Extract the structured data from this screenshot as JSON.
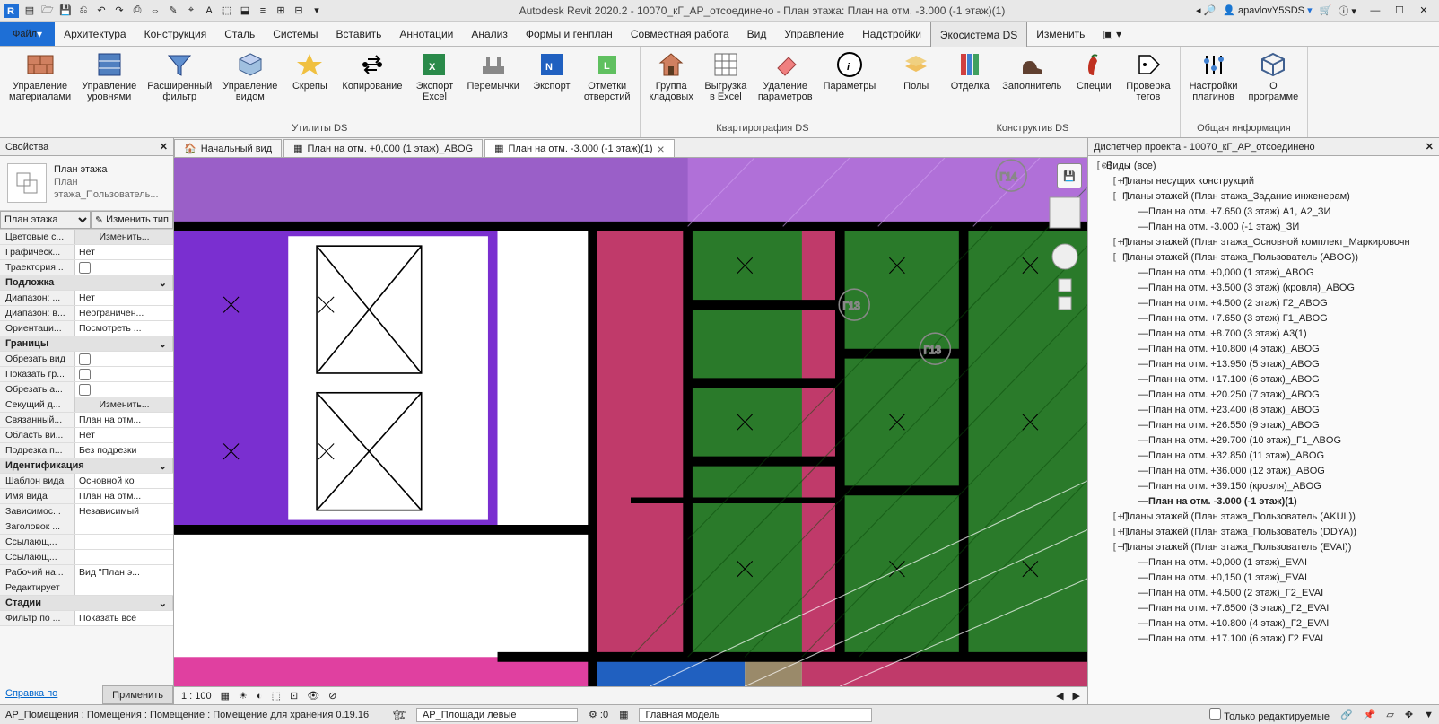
{
  "title": "Autodesk Revit 2020.2 - 10070_кГ_АР_отсоединено - План этажа: План на отм. -3.000 (-1 этаж)(1)",
  "user": "apavlovY5SDS",
  "menu": {
    "file": "Файл",
    "items": [
      "Архитектура",
      "Конструкция",
      "Сталь",
      "Системы",
      "Вставить",
      "Аннотации",
      "Анализ",
      "Формы и генплан",
      "Совместная работа",
      "Вид",
      "Управление",
      "Надстройки",
      "Экосистема DS",
      "Изменить"
    ],
    "active": 12
  },
  "ribbon": [
    {
      "label": "Утилиты DS",
      "btns": [
        {
          "t": "Управление\nматериалами",
          "icon": "bricks"
        },
        {
          "t": "Управление\nуровнями",
          "icon": "levels"
        },
        {
          "t": "Расширенный\nфильтр",
          "icon": "funnel"
        },
        {
          "t": "Управление\nвидом",
          "icon": "viewcube"
        },
        {
          "t": "Скрепы",
          "icon": "star"
        },
        {
          "t": "Копирование",
          "icon": "arrows"
        },
        {
          "t": "Экспорт\nExcel",
          "icon": "excel"
        },
        {
          "t": "Перемычки",
          "icon": "lintel"
        },
        {
          "t": "Экспорт",
          "icon": "navis"
        },
        {
          "t": "Отметки\nотверстий",
          "icon": "level"
        }
      ]
    },
    {
      "label": "Квартирография DS",
      "btns": [
        {
          "t": "Группа\nкладовых",
          "icon": "house"
        },
        {
          "t": "Выгрузка\nв Excel",
          "icon": "grid"
        },
        {
          "t": "Удаление\nпараметров",
          "icon": "eraser"
        },
        {
          "t": "Параметры",
          "icon": "info"
        }
      ]
    },
    {
      "label": "Конструктив DS",
      "btns": [
        {
          "t": "Полы",
          "icon": "floors"
        },
        {
          "t": "Отделка",
          "icon": "books"
        },
        {
          "t": "Заполнитель",
          "icon": "shoe"
        },
        {
          "t": "Специи",
          "icon": "pepper"
        },
        {
          "t": "Проверка\nтегов",
          "icon": "tag"
        }
      ]
    },
    {
      "label": "Общая информация",
      "btns": [
        {
          "t": "Настройки\nплагинов",
          "icon": "sliders"
        },
        {
          "t": "О\nпрограмме",
          "icon": "cube"
        }
      ]
    }
  ],
  "props": {
    "title": "Свойства",
    "typeName": "План этажа",
    "typeSub": "План этажа_Пользователь...",
    "selector": "План этажа",
    "editType": "Изменить тип",
    "rows": [
      {
        "n": "Цветовые с...",
        "v": "Изменить...",
        "btn": true
      },
      {
        "n": "Графическ...",
        "v": "Нет"
      },
      {
        "n": "Траектория...",
        "v": "",
        "chk": true,
        "checked": false
      }
    ],
    "cat1": "Подложка",
    "rows2": [
      {
        "n": "Диапазон: ...",
        "v": "Нет"
      },
      {
        "n": "Диапазон: в...",
        "v": "Неограничен..."
      },
      {
        "n": "Ориентаци...",
        "v": "Посмотреть ..."
      }
    ],
    "cat2": "Границы",
    "rows3": [
      {
        "n": "Обрезать вид",
        "v": "",
        "chk": true,
        "checked": false
      },
      {
        "n": "Показать гр...",
        "v": "",
        "chk": true,
        "checked": false
      },
      {
        "n": "Обрезать а...",
        "v": "",
        "chk": true,
        "checked": false
      },
      {
        "n": "Секущий д...",
        "v": "Изменить...",
        "btn": true
      },
      {
        "n": "Связанный...",
        "v": "План на отм..."
      },
      {
        "n": "Область ви...",
        "v": "Нет"
      },
      {
        "n": "Подрезка п...",
        "v": "Без подрезки"
      }
    ],
    "cat3": "Идентификация",
    "rows4": [
      {
        "n": "Шаблон вида",
        "v": "Основной ко"
      },
      {
        "n": "Имя вида",
        "v": "План на отм..."
      },
      {
        "n": "Зависимос...",
        "v": "Независимый"
      },
      {
        "n": "Заголовок ...",
        "v": ""
      },
      {
        "n": "Ссылающ...",
        "v": ""
      },
      {
        "n": "Ссылающ...",
        "v": ""
      },
      {
        "n": "Рабочий на...",
        "v": "Вид \"План э..."
      },
      {
        "n": "Редактирует",
        "v": ""
      }
    ],
    "cat4": "Стадии",
    "rows5": [
      {
        "n": "Фильтр по ...",
        "v": "Показать все"
      }
    ],
    "help": "Справка по",
    "apply": "Применить"
  },
  "tabs": [
    {
      "t": "Начальный вид",
      "active": false,
      "home": true
    },
    {
      "t": "План на отм. +0,000 (1 этаж)_ABOG",
      "active": false
    },
    {
      "t": "План на отм. -3.000 (-1 этаж)(1)",
      "active": true,
      "close": true
    }
  ],
  "zoom": "1 : 100",
  "browser": {
    "title": "Диспетчер проекта - 10070_кГ_АР_отсоединено",
    "nodes": [
      {
        "d": 0,
        "tw": "⊙",
        "t": "Виды (все)"
      },
      {
        "d": 1,
        "tw": "+",
        "t": "Планы несущих конструкций"
      },
      {
        "d": 1,
        "tw": "−",
        "t": "Планы этажей (План этажа_Задание инженерам)"
      },
      {
        "d": 2,
        "tw": "",
        "t": "План на отм. +7.650 (3 этаж) А1, А2_ЗИ"
      },
      {
        "d": 2,
        "tw": "",
        "t": "План на отм. -3.000 (-1 этаж)_ЗИ"
      },
      {
        "d": 1,
        "tw": "+",
        "t": "Планы этажей (План этажа_Основной комплект_Маркировочн"
      },
      {
        "d": 1,
        "tw": "−",
        "t": "Планы этажей (План этажа_Пользователь (ABOG))"
      },
      {
        "d": 2,
        "tw": "",
        "t": "План на отм. +0,000 (1 этаж)_ABOG"
      },
      {
        "d": 2,
        "tw": "",
        "t": "План на отм. +3.500 (3 этаж)  (кровля)_ABOG"
      },
      {
        "d": 2,
        "tw": "",
        "t": "План на отм. +4.500 (2 этаж) Г2_ABOG"
      },
      {
        "d": 2,
        "tw": "",
        "t": "План на отм. +7.650 (3 этаж) Г1_ABOG"
      },
      {
        "d": 2,
        "tw": "",
        "t": "План на отм. +8.700 (3 этаж) А3(1)"
      },
      {
        "d": 2,
        "tw": "",
        "t": "План на отм. +10.800 (4 этаж)_ABOG"
      },
      {
        "d": 2,
        "tw": "",
        "t": "План на отм. +13.950 (5 этаж)_ABOG"
      },
      {
        "d": 2,
        "tw": "",
        "t": "План на отм. +17.100 (6 этаж)_ABOG"
      },
      {
        "d": 2,
        "tw": "",
        "t": "План на отм. +20.250 (7 этаж)_ABOG"
      },
      {
        "d": 2,
        "tw": "",
        "t": "План на отм. +23.400 (8 этаж)_ABOG"
      },
      {
        "d": 2,
        "tw": "",
        "t": "План на отм. +26.550 (9 этаж)_ABOG"
      },
      {
        "d": 2,
        "tw": "",
        "t": "План на отм. +29.700 (10 этаж)_Г1_ABOG"
      },
      {
        "d": 2,
        "tw": "",
        "t": "План на отм. +32.850 (11 этаж)_ABOG"
      },
      {
        "d": 2,
        "tw": "",
        "t": "План на отм. +36.000 (12 этаж)_ABOG"
      },
      {
        "d": 2,
        "tw": "",
        "t": "План на отм. +39.150 (кровля)_ABOG"
      },
      {
        "d": 2,
        "tw": "",
        "t": "План на отм. -3.000 (-1 этаж)(1)",
        "sel": true
      },
      {
        "d": 1,
        "tw": "+",
        "t": "Планы этажей (План этажа_Пользователь (AKUL))"
      },
      {
        "d": 1,
        "tw": "+",
        "t": "Планы этажей (План этажа_Пользователь (DDYA))"
      },
      {
        "d": 1,
        "tw": "−",
        "t": "Планы этажей (План этажа_Пользователь (EVAI))"
      },
      {
        "d": 2,
        "tw": "",
        "t": "План на отм. +0,000 (1 этаж)_EVAI"
      },
      {
        "d": 2,
        "tw": "",
        "t": "План на отм. +0,150 (1 этаж)_EVAI"
      },
      {
        "d": 2,
        "tw": "",
        "t": "План на отм. +4.500 (2 этаж)_Г2_EVAI"
      },
      {
        "d": 2,
        "tw": "",
        "t": "План на отм. +7.6500 (3 этаж)_Г2_EVAI"
      },
      {
        "d": 2,
        "tw": "",
        "t": "План на отм. +10.800 (4 этаж)_Г2_EVAI"
      },
      {
        "d": 2,
        "tw": "",
        "t": "План на отм. +17.100 (6 этаж)  Г2  EVAI"
      }
    ]
  },
  "status": {
    "sel": "АР_Помещения : Помещения : Помещение : Помещение для хранения 0.19.16",
    "ws": "АР_Площади левые",
    "cnt": ":0",
    "model": "Главная модель",
    "editable": "Только редактируемые"
  }
}
